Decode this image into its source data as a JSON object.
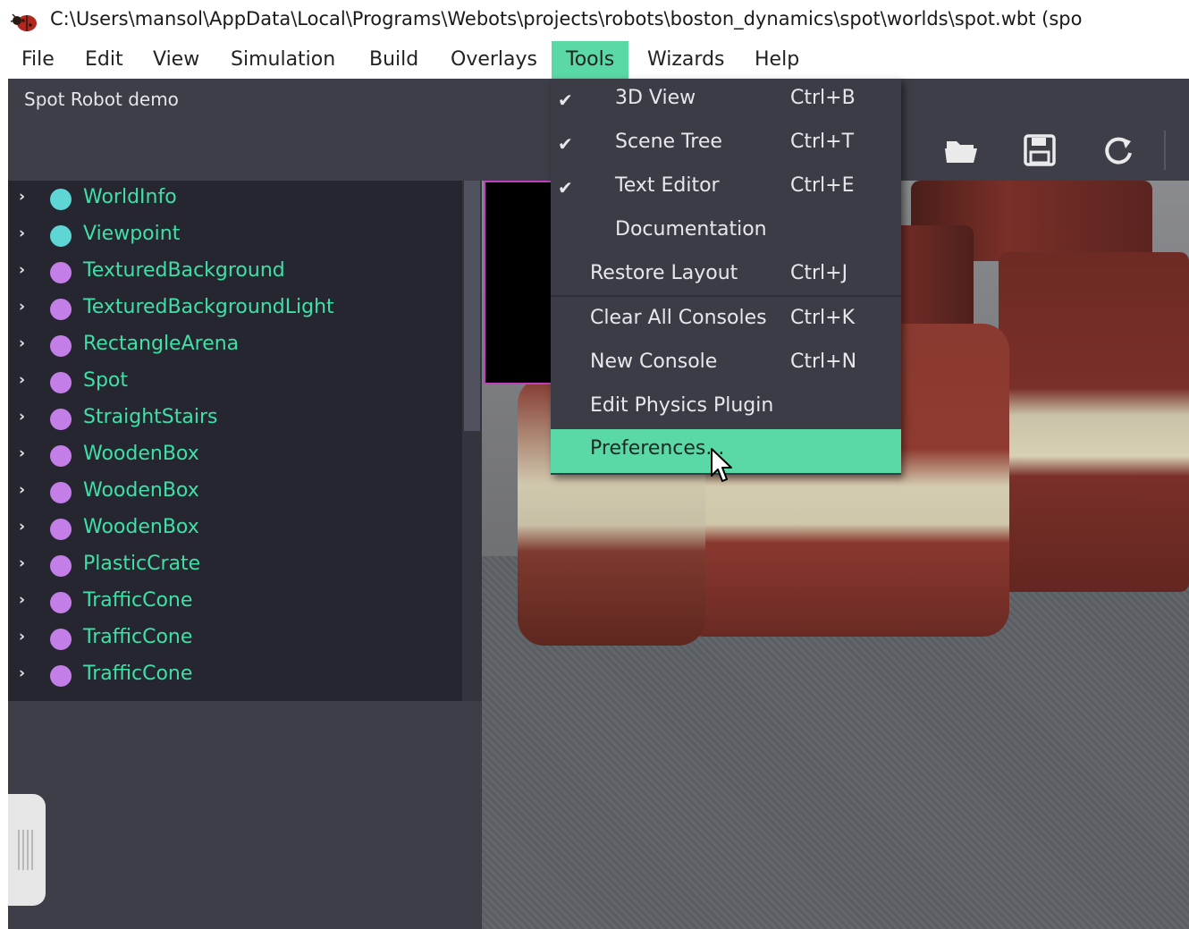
{
  "window": {
    "title": "C:\\Users\\mansol\\AppData\\Local\\Programs\\Webots\\projects\\robots\\boston_dynamics\\spot\\worlds\\spot.wbt (spo",
    "icon": "ladybug-icon"
  },
  "menubar": {
    "items": [
      {
        "label": "File"
      },
      {
        "label": "Edit"
      },
      {
        "label": "View"
      },
      {
        "label": "Simulation"
      },
      {
        "label": "Build"
      },
      {
        "label": "Overlays"
      },
      {
        "label": "Tools",
        "active": true
      },
      {
        "label": "Wizards"
      },
      {
        "label": "Help"
      }
    ]
  },
  "scene_tree": {
    "world_title": "Spot Robot demo",
    "nodes": [
      {
        "label": "WorldInfo",
        "color": "#5fd6d6"
      },
      {
        "label": "Viewpoint",
        "color": "#5fd6d6"
      },
      {
        "label": "TexturedBackground",
        "color": "#c47ee8"
      },
      {
        "label": "TexturedBackgroundLight",
        "color": "#c47ee8"
      },
      {
        "label": "RectangleArena",
        "color": "#c47ee8"
      },
      {
        "label": "Spot",
        "color": "#c47ee8"
      },
      {
        "label": "StraightStairs",
        "color": "#c47ee8"
      },
      {
        "label": "WoodenBox",
        "color": "#c47ee8"
      },
      {
        "label": "WoodenBox",
        "color": "#c47ee8"
      },
      {
        "label": "WoodenBox",
        "color": "#c47ee8"
      },
      {
        "label": "PlasticCrate",
        "color": "#c47ee8"
      },
      {
        "label": "TrafficCone",
        "color": "#c47ee8"
      },
      {
        "label": "TrafficCone",
        "color": "#c47ee8"
      },
      {
        "label": "TrafficCone",
        "color": "#c47ee8"
      }
    ]
  },
  "toolbar": {
    "icons": [
      "folder-open-icon",
      "save-icon",
      "reload-icon"
    ]
  },
  "tools_menu": {
    "items": [
      {
        "label": "3D View",
        "shortcut": "Ctrl+B",
        "checked": true
      },
      {
        "label": "Scene Tree",
        "shortcut": "Ctrl+T",
        "checked": true
      },
      {
        "label": "Text Editor",
        "shortcut": "Ctrl+E",
        "checked": true
      },
      {
        "label": "Documentation",
        "shortcut": "",
        "checked": false
      },
      {
        "label": "Restore Layout",
        "shortcut": "Ctrl+J"
      },
      {
        "label": "Clear All Consoles",
        "shortcut": "Ctrl+K"
      },
      {
        "label": "New Console",
        "shortcut": "Ctrl+N"
      },
      {
        "label": "Edit Physics Plugin",
        "shortcut": ""
      },
      {
        "label": "Preferences...",
        "shortcut": "",
        "highlighted": true
      }
    ]
  },
  "colors": {
    "accent": "#5ad8a6",
    "node_label": "#3fe0a6",
    "panel_bg": "#3d3e47",
    "tree_bg": "#252630"
  }
}
